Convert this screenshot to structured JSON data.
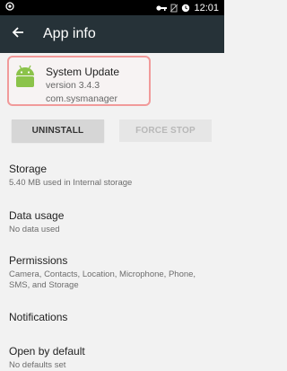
{
  "status_bar": {
    "time": "12:01",
    "icons": [
      "notification-icon",
      "key-icon",
      "no-sim-icon",
      "alarm-icon"
    ]
  },
  "app_bar": {
    "title": "App info",
    "back_icon": "back-arrow-icon"
  },
  "app": {
    "name": "System Update",
    "version": "version 3.4.3",
    "package": "com.sysmanager",
    "icon": "android-icon",
    "icon_color": "#8bc34a"
  },
  "buttons": {
    "uninstall": "UNINSTALL",
    "force_stop": "FORCE STOP"
  },
  "settings": [
    {
      "title": "Storage",
      "subtitle": "5.40 MB used in Internal storage"
    },
    {
      "title": "Data usage",
      "subtitle": "No data used"
    },
    {
      "title": "Permissions",
      "subtitle": "Camera, Contacts, Location, Microphone, Phone, SMS, and Storage"
    },
    {
      "title": "Notifications",
      "subtitle": ""
    },
    {
      "title": "Open by default",
      "subtitle": "No defaults set"
    }
  ],
  "colors": {
    "app_bar": "#263238",
    "highlight_border": "#f19a9a",
    "background": "#f2f2f2"
  }
}
